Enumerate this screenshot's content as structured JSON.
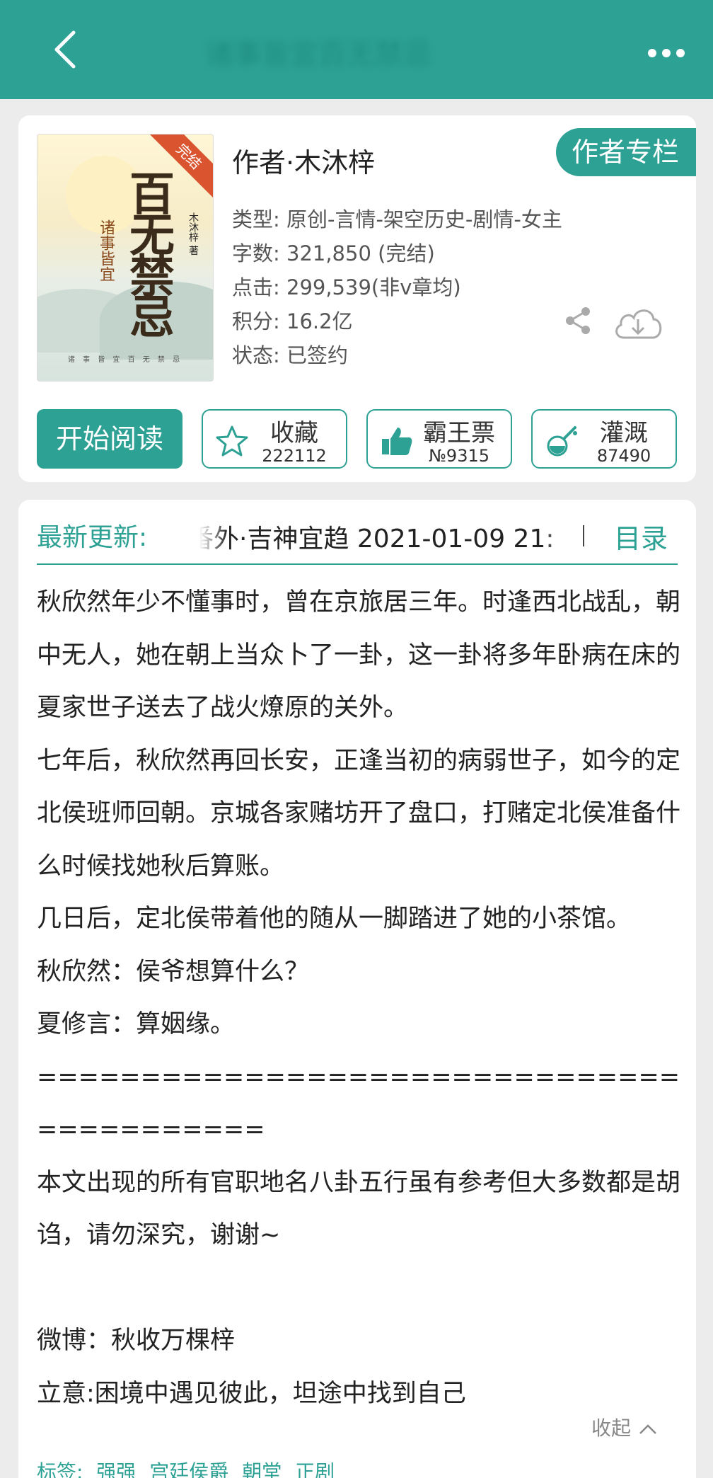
{
  "colors": {
    "accent": "#2da194",
    "ribbon": "#d9542f"
  },
  "topbar": {
    "title": "诸事皆宜百无禁忌",
    "back_icon": "chevron-left-icon",
    "more_icon": "more-dots-icon"
  },
  "book": {
    "cover": {
      "ribbon": "完结",
      "title_art": "百无禁忌",
      "subtitle_art": "诸事皆宜",
      "author_art": "木沐梓 著",
      "footer_art": "诸 事 皆 宜 百 无 禁 忌"
    },
    "author_line": "作者·木沐梓",
    "author_column_button": "作者专栏",
    "info": [
      "类型: 原创-言情-架空历史-剧情-女主",
      "字数: 321,850 (完结)",
      "点击: 299,539(非v章均)",
      "积分: 16.2亿",
      "状态: 已签约"
    ],
    "share_icon": "share-icon",
    "download_icon": "cloud-download-icon"
  },
  "actions": {
    "read": "开始阅读",
    "favorite": {
      "label": "收藏",
      "count": "222112",
      "icon": "star-icon"
    },
    "ticket": {
      "label": "霸王票",
      "count": "№9315",
      "icon": "thumbs-up-icon"
    },
    "water": {
      "label": "灌溉",
      "count": "87490",
      "icon": "nutrient-bottle-icon"
    }
  },
  "latest": {
    "label": "最新更新:",
    "text": "番外·吉神宜趋  2021-01-09 21:",
    "catalog": "目录"
  },
  "intro": [
    "秋欣然年少不懂事时，曾在京旅居三年。时逢西北战乱，朝中无人，她在朝上当众卜了一卦，这一卦将多年卧病在床的夏家世子送去了战火燎原的关外。",
    "七年后，秋欣然再回长安，正逢当初的病弱世子，如今的定北侯班师回朝。京城各家赌坊开了盘口，打赌定北侯准备什么时候找她秋后算账。",
    "几日后，定北侯带着他的随从一脚踏进了她的小茶馆。",
    "秋欣然：侯爷想算什么？",
    "夏修言：算姻缘。",
    "==========================================",
    "本文出现的所有官职地名八卦五行虽有参考但大多数都是胡诌，请勿深究，谢谢~",
    "",
    "微博：秋收万棵梓",
    "立意:困境中遇见彼此，坦途中找到自己"
  ],
  "collapse": "收起",
  "tags": {
    "label": "标签:",
    "items": [
      "强强",
      "宫廷侯爵",
      "朝堂",
      "正剧"
    ]
  }
}
